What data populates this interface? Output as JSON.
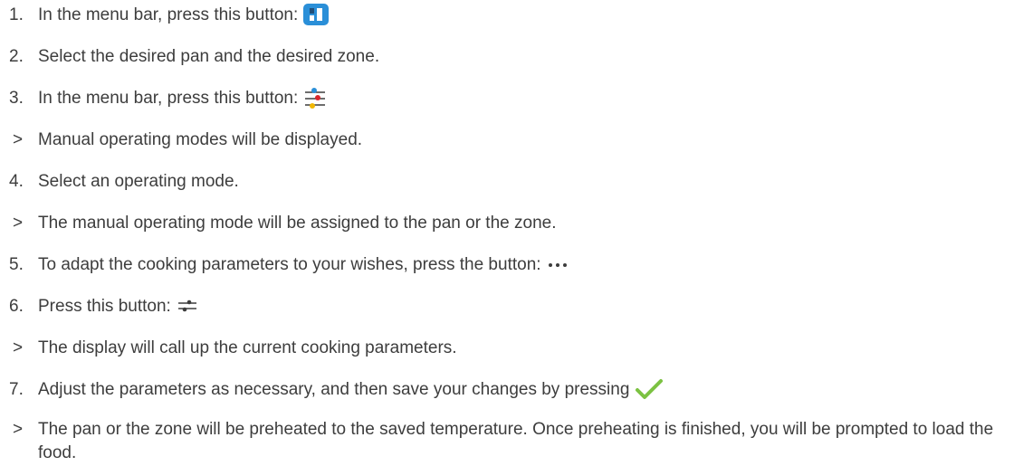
{
  "steps": [
    {
      "marker": "1.",
      "text": "In the menu bar, press this button:",
      "icon": "pan-overview-icon"
    },
    {
      "marker": "2.",
      "text": "Select the desired pan and the desired zone."
    },
    {
      "marker": "3.",
      "text": "In the menu bar, press this button:",
      "icon": "manual-modes-icon"
    },
    {
      "marker": ">",
      "text": "Manual operating modes will be displayed."
    },
    {
      "marker": "4.",
      "text": "Select an operating mode."
    },
    {
      "marker": ">",
      "text": "The manual operating mode will be assigned to the pan or the zone."
    },
    {
      "marker": "5.",
      "text": "To adapt the cooking parameters to your wishes, press the button:",
      "icon": "more-dots-icon"
    },
    {
      "marker": "6.",
      "text": "Press this button:",
      "icon": "parameters-icon"
    },
    {
      "marker": ">",
      "text": "The display will call up the current cooking parameters."
    },
    {
      "marker": "7.",
      "text": "Adjust the parameters as necessary, and then save your changes by pressing",
      "icon": "checkmark-icon"
    },
    {
      "marker": ">",
      "text": "The pan or the zone will be preheated to the saved temperature. Once preheating is finished, you will be prompted to load the food."
    }
  ],
  "colors": {
    "text": "#3d3d3d",
    "blue": "#2a8fd8",
    "red": "#d8262c",
    "yellow": "#f2b705",
    "green": "#7cc242"
  }
}
